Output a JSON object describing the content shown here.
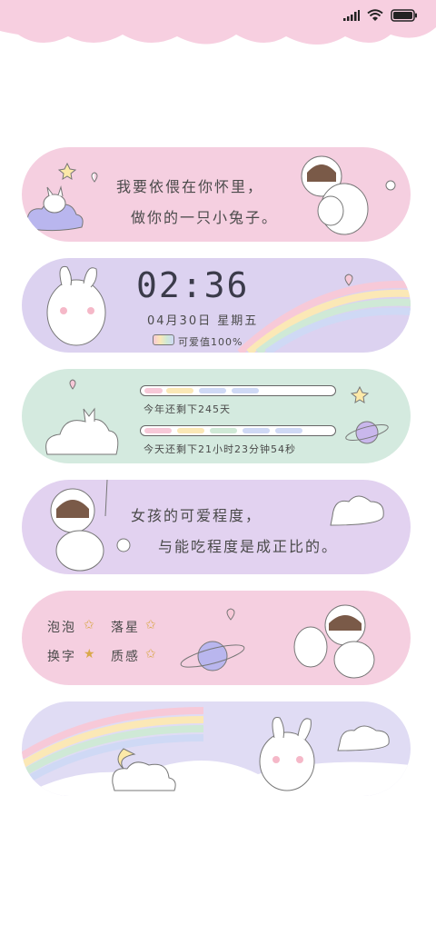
{
  "card1": {
    "line1": "我要依偎在你怀里，",
    "line2": "做你的一只小兔子。"
  },
  "card2": {
    "time": "02:36",
    "date": "04月30日 星期五",
    "battery_label": "可爱值100%",
    "battery_level": 1.0
  },
  "card3": {
    "year_text": "今年还剩下245天",
    "day_text": "今天还剩下21小时23分钟54秒"
  },
  "card4": {
    "line1": "女孩的可爱程度，",
    "line2": "与能吃程度是成正比的。"
  },
  "card5": {
    "row1": [
      "泡泡",
      "落星"
    ],
    "row2": [
      "换字",
      "质感"
    ]
  },
  "colors": {
    "pink": "#f5cfe0",
    "lavender": "#dcd2f0",
    "mint": "#d4eadf",
    "purple": "#e2d2f0"
  }
}
